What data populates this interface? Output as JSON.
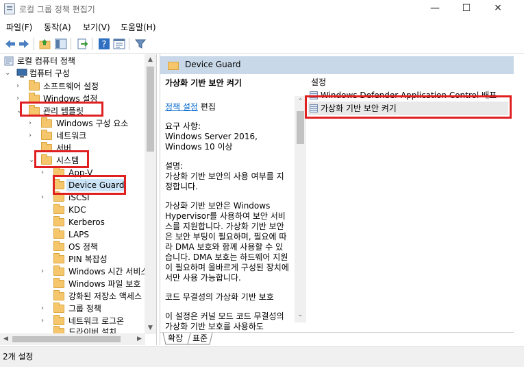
{
  "window": {
    "title": "로컬 그룹 정책 편집기",
    "minimize": "—",
    "maximize": "☐",
    "close": "✕"
  },
  "menu": [
    "파일(F)",
    "동작(A)",
    "보기(V)",
    "도움말(H)"
  ],
  "toolbar": {
    "icons": [
      "back-arrow-icon",
      "forward-arrow-icon",
      "up-folder-icon",
      "show-hide-tree-icon",
      "export-list-icon",
      "help-icon",
      "properties-icon",
      "filter-icon"
    ]
  },
  "tree": {
    "items": [
      {
        "label": "로컬 컴퓨터 정책",
        "icon": "policy-icon"
      },
      {
        "label": "컴퓨터 구성",
        "icon": "computer-icon"
      },
      {
        "label": "소프트웨어 설정"
      },
      {
        "label": "Windows 설정"
      },
      {
        "label": "관리 템플릿"
      },
      {
        "label": "Windows 구성 요소"
      },
      {
        "label": "네트워크"
      },
      {
        "label": "서버"
      },
      {
        "label": "시스템"
      },
      {
        "label": "App-V"
      },
      {
        "label": "Device Guard"
      },
      {
        "label": "iSCSI"
      },
      {
        "label": "KDC"
      },
      {
        "label": "Kerberos"
      },
      {
        "label": "LAPS"
      },
      {
        "label": "OS 정책"
      },
      {
        "label": "PIN 복잡성"
      },
      {
        "label": "Windows 시간 서비스"
      },
      {
        "label": "Windows 파일 보호"
      },
      {
        "label": "강화된 저장소 액세스"
      },
      {
        "label": "그룹 정책"
      },
      {
        "label": "네트워크 로그온"
      },
      {
        "label": "드라이버 설치"
      }
    ]
  },
  "right": {
    "header": "Device Guard",
    "description": {
      "title": "가상화 기반 보안 켜기",
      "edit_link": "정책 설정",
      "edit_suffix": " 편집",
      "requirements": "요구 사항:\nWindows Server 2016, Windows 10 이상",
      "description_body": "설명:\n가상화 기반 보안의 사용 여부를 지정합니다.",
      "para2": "가상화 기반 보안은 Windows Hypervisor를 사용하여 보안 서비스를 지원합니다. 가상화 기반 보안은 보안 부팅이 필요하며, 필요에 따라 DMA 보호와 함께 사용할 수 있습니다. DMA 보호는 하드웨어 지원이 필요하며 올바르게 구성된 장치에서만 사용 가능합니다.",
      "para3": "코드 무결성의 가상화 기반 보호",
      "para4": "이 설정은 커널 모드 코드 무결성의 가상화 기반 보호를 사용하도"
    },
    "list": {
      "column": "설정",
      "rows": [
        "Windows Defender Application Control 배포",
        "가상화 기반 보안 켜기"
      ]
    },
    "tabs": [
      "확장",
      "표준"
    ]
  },
  "status": {
    "text": "2개 설정"
  }
}
